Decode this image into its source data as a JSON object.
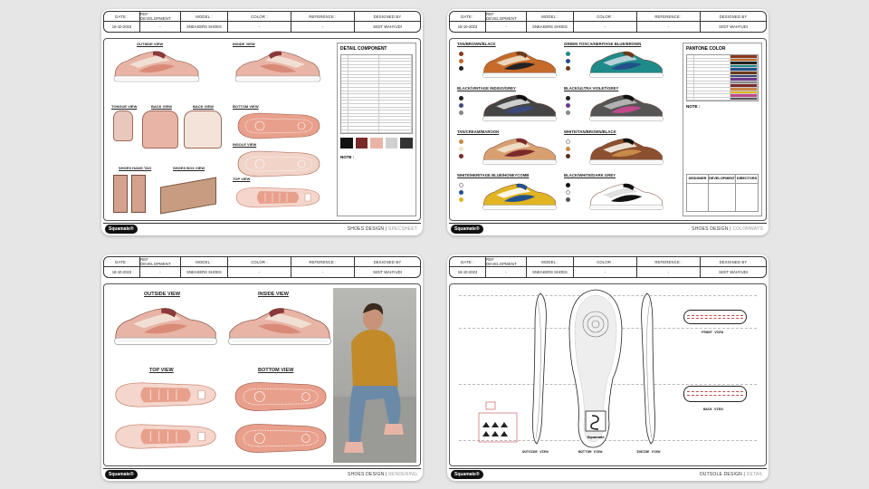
{
  "header": {
    "labels": [
      "DATE :",
      "REF DEVELOPMENT",
      "MODEL :",
      "COLOR :",
      "REFERENCE :",
      "DESIGNED BY"
    ],
    "values": [
      "18-10-2023",
      "-",
      "SNEAKERS SHOES",
      "-",
      "-",
      "SIGIT WAHYUDI"
    ]
  },
  "brand": "Squamate®",
  "sheets": [
    {
      "footer_main": "SHOES DESIGN |",
      "footer_sub": "SPECSHEET",
      "views": [
        "OUTSIDE VIEW",
        "INSIDE VIEW",
        "TONGUE VIEW",
        "BACK VIEW",
        "BACK VIEW",
        "BOTTOM VIEW",
        "INSOLE VIEW",
        "SHOES HANG TAG",
        "SHOES BOX VIEW",
        "TOP VIEW"
      ],
      "panel_title": "DETAIL COMPONENT",
      "note": "NOTE :"
    },
    {
      "footer_main": "SHOES DESIGN |",
      "footer_sub": "COLORWAYS",
      "colorways": [
        "TAN/BROWN/BLACK",
        "GREEN TOSCA/HERITAGE BLUE/BROWN",
        "BLACK/VINTAGE INDIGO/GREY",
        "BLACK/ULTRA VIOLET/GREY",
        "TAN/CREAM/MAROON",
        "WHITE/TAN/BROWN/BLACK",
        "WHITE/HERITAGE BLUE/HONEYCOMB",
        "BLACK/WHITE/DARK GREY"
      ],
      "panel_title": "PANTONE COLOR",
      "note": "NOTE :",
      "approval": [
        "DESIGNER",
        "DEVELOPMENT",
        "DIRECTORS"
      ]
    },
    {
      "footer_main": "SHOES DESIGN |",
      "footer_sub": "RENDERING",
      "views": [
        "OUTSIDE VIEW",
        "INSIDE VIEW",
        "TOP VIEW",
        "BOTTOM VIEW"
      ]
    },
    {
      "footer_main": "OUTSOLE DESIGN |",
      "footer_sub": "DETAIL",
      "views": [
        "OUTSIDE VIEW",
        "BOTTOM VIEW",
        "INSIDE VIEW",
        "FRONT VIEW",
        "BACK VIEW"
      ],
      "sole_brand": "Squamate"
    }
  ],
  "colors": {
    "blush": "#e8b4a6",
    "salmon": "#d98b78",
    "cream": "#f3e3d8",
    "maroon": "#8a3a3a",
    "sole": "#ffffff",
    "swatches_1": [
      "#8a3a1c",
      "#c46a2b",
      "#222222",
      "#6b3b1b"
    ],
    "swatches_2": [
      "#1f8a8a",
      "#23508a",
      "#6b3b1b",
      "#111111"
    ],
    "swatches_3": [
      "#222222",
      "#3b4a7a",
      "#888888"
    ],
    "swatches_4": [
      "#222222",
      "#6b3a8a",
      "#888888"
    ],
    "swatches_5": [
      "#c98a4a",
      "#f0e2c8",
      "#7a2a2a"
    ],
    "swatches_6": [
      "#ffffff",
      "#c98a4a",
      "#5a2e15",
      "#111111"
    ],
    "swatches_7": [
      "#ffffff",
      "#23508a",
      "#e0b422"
    ],
    "swatches_8": [
      "#111111",
      "#ffffff",
      "#555555"
    ]
  }
}
